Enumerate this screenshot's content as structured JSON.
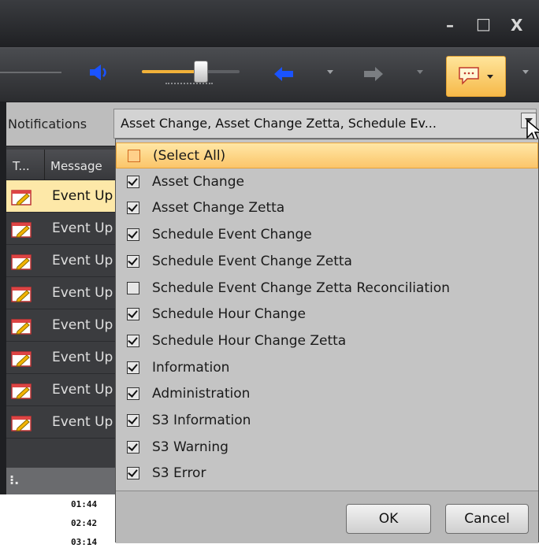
{
  "window": {
    "minimize_glyph": "–",
    "maximize_glyph": "□",
    "close_glyph": "X"
  },
  "toolbar": {
    "volume_level": 0.6,
    "accent": "#f7c95a",
    "icons": [
      "volume-icon",
      "back-arrow-icon",
      "forward-arrow-icon",
      "message-icon"
    ]
  },
  "notifications": {
    "label": "Notifications",
    "value": "Asset Change, Asset Change Zetta, Schedule Ev..."
  },
  "grid": {
    "col_type": "T...",
    "col_message": "Message",
    "rows": [
      {
        "message": "Event Up"
      },
      {
        "message": "Event Up"
      },
      {
        "message": "Event Up"
      },
      {
        "message": "Event Up"
      },
      {
        "message": "Event Up"
      },
      {
        "message": "Event Up"
      },
      {
        "message": "Event Up"
      },
      {
        "message": "Event Up"
      }
    ],
    "status_glyph": "⁝."
  },
  "dropdown": {
    "items": [
      {
        "label": "(Select All)",
        "checked": false
      },
      {
        "label": "Asset Change",
        "checked": true
      },
      {
        "label": "Asset Change Zetta",
        "checked": true
      },
      {
        "label": "Schedule Event Change",
        "checked": true
      },
      {
        "label": "Schedule Event Change Zetta",
        "checked": true
      },
      {
        "label": "Schedule Event Change Zetta Reconciliation",
        "checked": false
      },
      {
        "label": "Schedule Hour Change",
        "checked": true
      },
      {
        "label": "Schedule Hour Change Zetta",
        "checked": true
      },
      {
        "label": "Information",
        "checked": true
      },
      {
        "label": "Administration",
        "checked": true
      },
      {
        "label": "S3 Information",
        "checked": true
      },
      {
        "label": "S3 Warning",
        "checked": true
      },
      {
        "label": "S3 Error",
        "checked": true
      }
    ],
    "ok_label": "OK",
    "cancel_label": "Cancel"
  },
  "background_times": [
    "01:44",
    "02:42",
    "03:14"
  ]
}
